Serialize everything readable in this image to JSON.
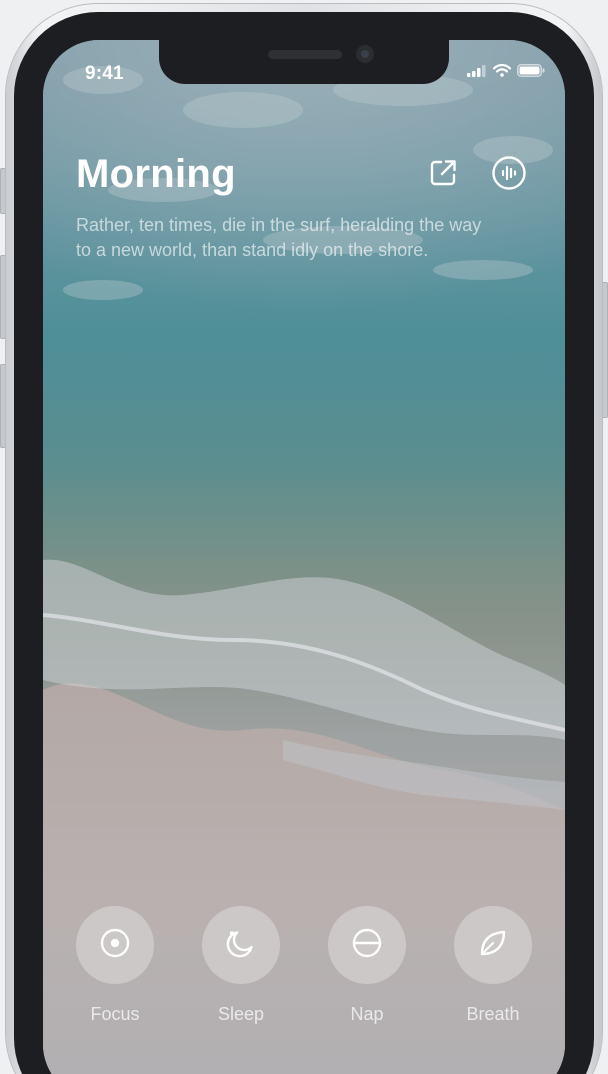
{
  "status_bar": {
    "time": "9:41"
  },
  "screen": {
    "title": "Morning",
    "quote": "Rather, ten times, die in the surf, heralding the way to a new world, than stand idly on the shore."
  },
  "header_actions": [
    {
      "name": "share",
      "icon": "share-external-icon"
    },
    {
      "name": "sound",
      "icon": "waveform-icon"
    }
  ],
  "modes": [
    {
      "label": "Focus",
      "icon": "target-icon"
    },
    {
      "label": "Sleep",
      "icon": "moon-icon"
    },
    {
      "label": "Nap",
      "icon": "half-circle-icon"
    },
    {
      "label": "Breath",
      "icon": "leaf-icon"
    }
  ],
  "colors": {
    "text": "#ffffff",
    "mode_button_fill": "rgba(255,255,255,0.30)",
    "frame": "#1d1e21"
  }
}
